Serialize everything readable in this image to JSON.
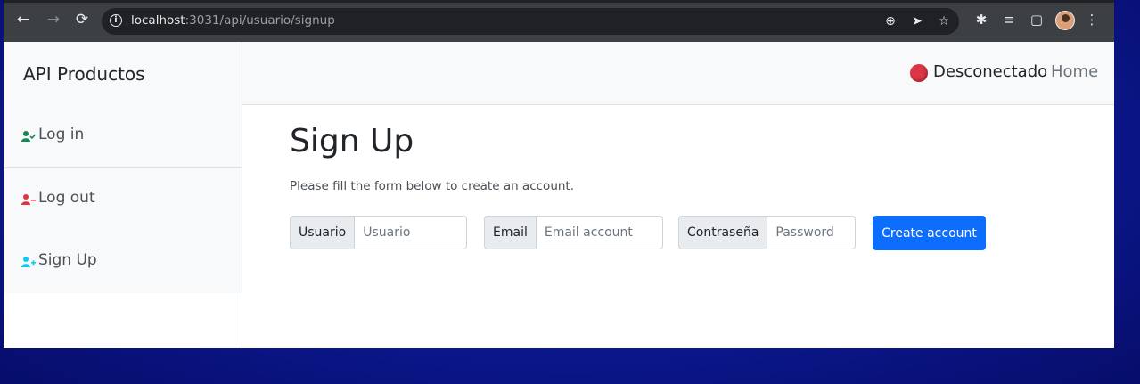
{
  "browser": {
    "url_host": "localhost",
    "url_path": ":3031/api/usuario/signup"
  },
  "sidebar": {
    "brand": "API Productos",
    "items": [
      {
        "label": "Log in",
        "icon": "user-check-icon",
        "color": "#198754"
      },
      {
        "label": "Log out",
        "icon": "user-minus-icon",
        "color": "#dc3545"
      },
      {
        "label": "Sign Up",
        "icon": "user-plus-icon",
        "color": "#0dcaf0"
      }
    ]
  },
  "header": {
    "status_text": "Desconectado",
    "status_color": "#dc3545",
    "home_label": "Home"
  },
  "form": {
    "title": "Sign Up",
    "subtitle": "Please fill the form below to create an account.",
    "fields": [
      {
        "label": "Usuario",
        "placeholder": "Usuario",
        "value": ""
      },
      {
        "label": "Email",
        "placeholder": "Email account",
        "value": ""
      },
      {
        "label": "Contraseña",
        "placeholder": "Password",
        "value": ""
      }
    ],
    "submit_label": "Create account"
  },
  "colors": {
    "primary": "#0d6efd",
    "background_gradient": "#0c1890"
  }
}
